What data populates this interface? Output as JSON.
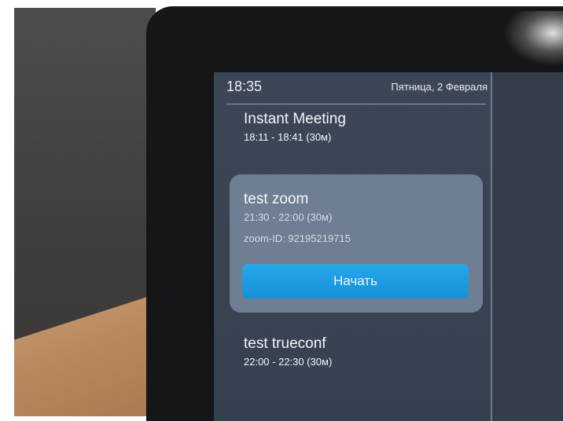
{
  "header": {
    "time": "18:35",
    "date": "Пятница, 2 Февраля"
  },
  "events": [
    {
      "title": "Instant Meeting",
      "time": "18:11 - 18:41 (30м)"
    },
    {
      "title": "test zoom",
      "time": "21:30 - 22:00 (30м)",
      "meeting_id": "zoom-ID: 92195219715",
      "start_label": "Начать"
    },
    {
      "title": "test trueconf",
      "time": "22:00 - 22:30 (30м)"
    }
  ],
  "colors": {
    "screen_bg": "#3b4655",
    "selected_card": "#6f7e93",
    "start_button": "#1b9be2"
  }
}
